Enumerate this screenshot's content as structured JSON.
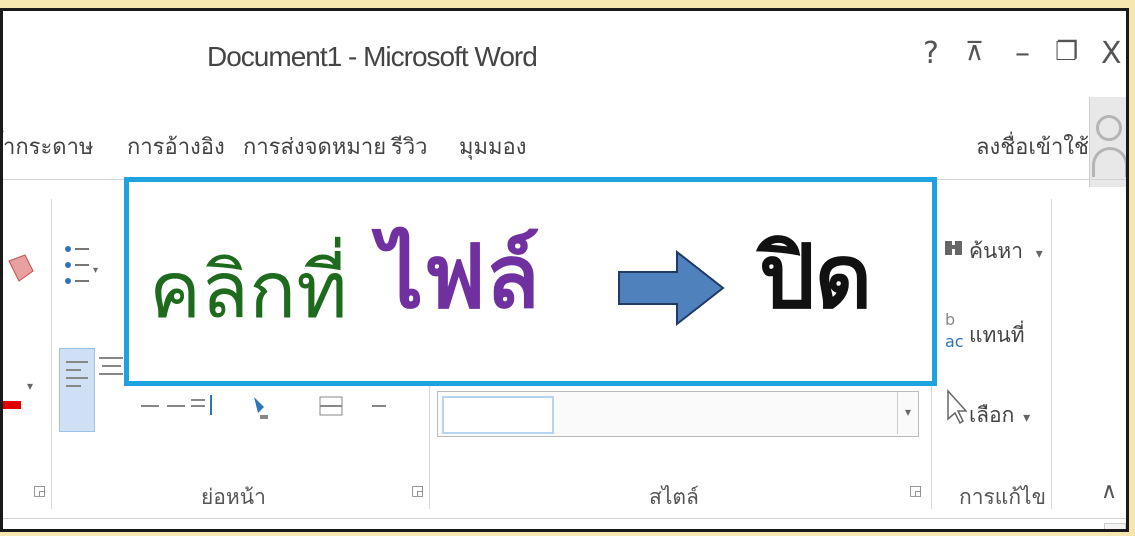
{
  "window": {
    "title": "Document1 - Microsoft Word",
    "help": "?",
    "ribbon_display": "⊼",
    "minimize": "–",
    "restore": "❐",
    "close": "X"
  },
  "tabs": [
    "้ากระดาษ",
    "การอ้างอิง",
    "การส่งจดหมาย",
    "รีวิว",
    "มุมมอง"
  ],
  "signin": "ลงชื่อเข้าใช้",
  "groups": {
    "paragraph": "ย่อหน้า",
    "styles": "สไตล์",
    "editing": "การแก้ไข"
  },
  "editing": {
    "find": "ค้นหา",
    "replace": "แทนที่",
    "select": "เลือก"
  },
  "callout": {
    "prefix": "คลิกที่",
    "menu": "ไฟล์",
    "action": "ปิด",
    "border_color": "#1fa3df",
    "prefix_color": "#1e6b1e",
    "menu_color": "#7030a0",
    "arrow_color": "#4f81bd"
  },
  "collapse_icon": "∧"
}
